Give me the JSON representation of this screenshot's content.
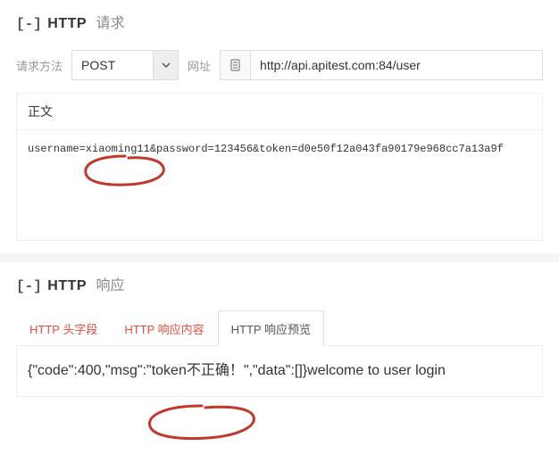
{
  "request": {
    "collapse": "[ - ]",
    "http_label": "HTTP",
    "sub": "请求",
    "method_label": "请求方法",
    "method_value": "POST",
    "url_label": "网址",
    "url_value": "http://api.apitest.com:84/user",
    "body_title": "正文",
    "body_value": "username=xiaoming11&password=123456&token=d0e50f12a043fa90179e968cc7a13a9f"
  },
  "response": {
    "collapse": "[ - ]",
    "http_label": "HTTP",
    "sub": "响应",
    "tabs": [
      {
        "label": "HTTP 头字段"
      },
      {
        "label": "HTTP 响应内容"
      },
      {
        "label": "HTTP 响应预览"
      }
    ],
    "active_tab": 2,
    "preview_text": "{\"code\":400,\"msg\":\"token不正确！\",\"data\":[]}welcome to user login"
  }
}
